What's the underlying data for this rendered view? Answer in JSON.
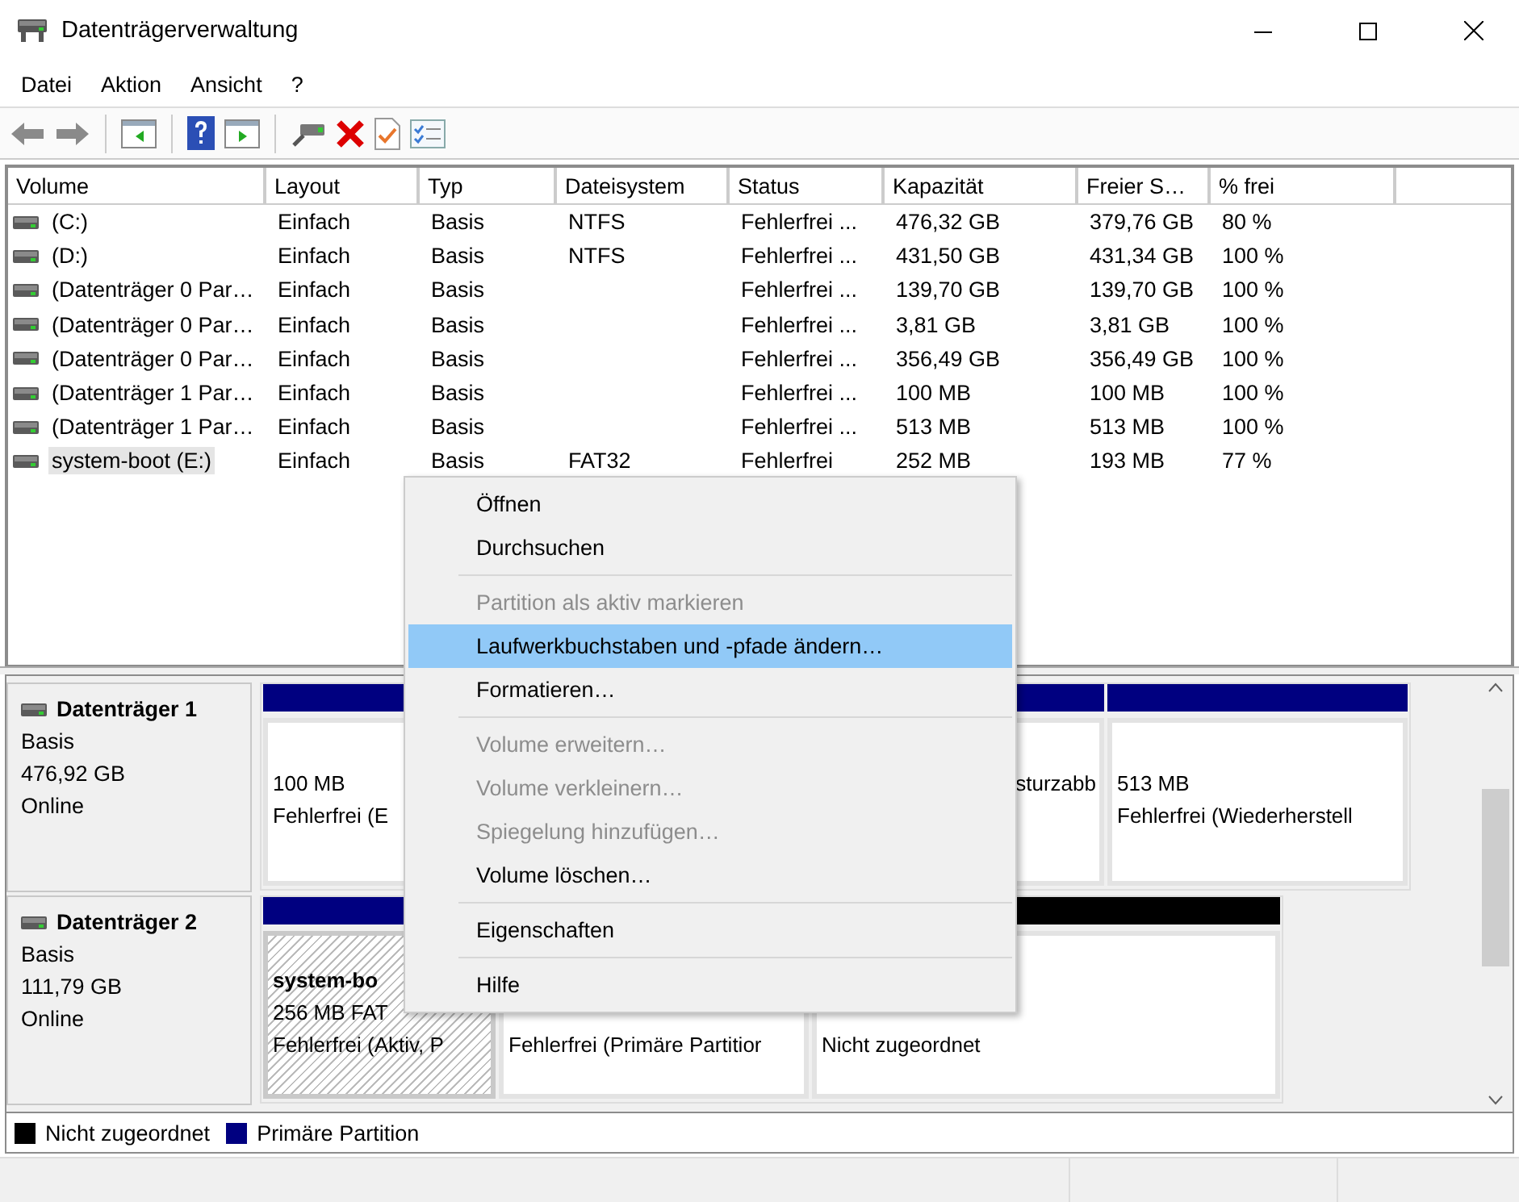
{
  "window": {
    "title": "Datenträgerverwaltung"
  },
  "menu_bar": [
    "Datei",
    "Aktion",
    "Ansicht",
    "?"
  ],
  "volume_table": {
    "columns": [
      "Volume",
      "Layout",
      "Typ",
      "Dateisystem",
      "Status",
      "Kapazität",
      "Freier S…",
      "% frei"
    ],
    "rows": [
      {
        "selected": false,
        "cells": [
          "(C:)",
          "Einfach",
          "Basis",
          "NTFS",
          "Fehlerfrei ...",
          "476,32 GB",
          "379,76 GB",
          "80 %"
        ]
      },
      {
        "selected": false,
        "cells": [
          "(D:)",
          "Einfach",
          "Basis",
          "NTFS",
          "Fehlerfrei ...",
          "431,50 GB",
          "431,34 GB",
          "100 %"
        ]
      },
      {
        "selected": false,
        "cells": [
          "(Datenträger 0 Par…",
          "Einfach",
          "Basis",
          "",
          "Fehlerfrei ...",
          "139,70 GB",
          "139,70 GB",
          "100 %"
        ]
      },
      {
        "selected": false,
        "cells": [
          "(Datenträger 0 Par…",
          "Einfach",
          "Basis",
          "",
          "Fehlerfrei ...",
          "3,81 GB",
          "3,81 GB",
          "100 %"
        ]
      },
      {
        "selected": false,
        "cells": [
          "(Datenträger 0 Par…",
          "Einfach",
          "Basis",
          "",
          "Fehlerfrei ...",
          "356,49 GB",
          "356,49 GB",
          "100 %"
        ]
      },
      {
        "selected": false,
        "cells": [
          "(Datenträger 1 Par…",
          "Einfach",
          "Basis",
          "",
          "Fehlerfrei ...",
          "100 MB",
          "100 MB",
          "100 %"
        ]
      },
      {
        "selected": false,
        "cells": [
          "(Datenträger 1 Par…",
          "Einfach",
          "Basis",
          "",
          "Fehlerfrei ...",
          "513 MB",
          "513 MB",
          "100 %"
        ]
      },
      {
        "selected": true,
        "cells": [
          "system-boot (E:)",
          "Einfach",
          "Basis",
          "FAT32",
          "Fehlerfrei",
          "252 MB",
          "193 MB",
          "77 %"
        ]
      }
    ]
  },
  "disks": [
    {
      "name": "Datenträger 1",
      "type": "Basis",
      "size": "476,92 GB",
      "state": "Online",
      "partitions": [
        {
          "kind": "primary",
          "selected": false,
          "lines": [
            "100 MB",
            "Fehlerfrei (E"
          ]
        },
        {
          "kind": "primary",
          "selected": false,
          "lines": [
            "sturzabb"
          ]
        },
        {
          "kind": "primary",
          "selected": false,
          "lines": [
            "513 MB",
            "Fehlerfrei (Wiederherstell"
          ]
        }
      ]
    },
    {
      "name": "Datenträger 2",
      "type": "Basis",
      "size": "111,79 GB",
      "state": "Online",
      "partitions": [
        {
          "kind": "primary",
          "selected": true,
          "title": "system-bo",
          "lines": [
            "256 MB FAT",
            "Fehlerfrei (Aktiv, P"
          ]
        },
        {
          "kind": "primary",
          "selected": false,
          "lines": [
            "Fehlerfrei (Primäre Partitior"
          ]
        },
        {
          "kind": "unallocated",
          "selected": false,
          "lines": [
            "Nicht zugeordnet"
          ]
        }
      ]
    }
  ],
  "legend": [
    {
      "kind": "unallocated",
      "label": "Nicht zugeordnet"
    },
    {
      "kind": "primary",
      "label": "Primäre Partition"
    }
  ],
  "context_menu": [
    {
      "kind": "item",
      "label": "Öffnen",
      "disabled": false,
      "selected": false
    },
    {
      "kind": "item",
      "label": "Durchsuchen",
      "disabled": false,
      "selected": false
    },
    {
      "kind": "separator"
    },
    {
      "kind": "item",
      "label": "Partition als aktiv markieren",
      "disabled": true,
      "selected": false
    },
    {
      "kind": "item",
      "label": "Laufwerkbuchstaben und -pfade ändern…",
      "disabled": false,
      "selected": true
    },
    {
      "kind": "item",
      "label": "Formatieren…",
      "disabled": false,
      "selected": false
    },
    {
      "kind": "separator"
    },
    {
      "kind": "item",
      "label": "Volume erweitern…",
      "disabled": true,
      "selected": false
    },
    {
      "kind": "item",
      "label": "Volume verkleinern…",
      "disabled": true,
      "selected": false
    },
    {
      "kind": "item",
      "label": "Spiegelung hinzufügen…",
      "disabled": true,
      "selected": false
    },
    {
      "kind": "item",
      "label": "Volume löschen…",
      "disabled": false,
      "selected": false
    },
    {
      "kind": "separator"
    },
    {
      "kind": "item",
      "label": "Eigenschaften",
      "disabled": false,
      "selected": false
    },
    {
      "kind": "separator"
    },
    {
      "kind": "item",
      "label": "Hilfe",
      "disabled": false,
      "selected": false
    }
  ]
}
